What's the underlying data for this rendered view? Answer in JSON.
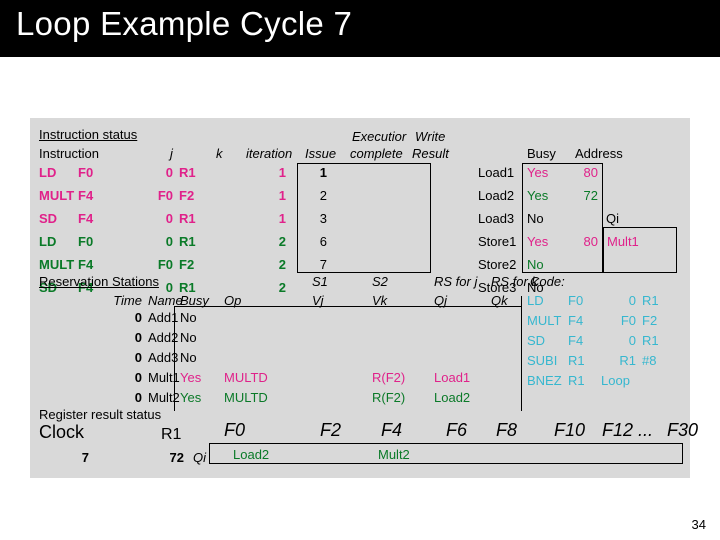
{
  "slide": {
    "title": "Loop Example Cycle 7",
    "page_number": "34"
  },
  "instruction_status": {
    "section_label": "Instruction status",
    "headers": {
      "instruction": "Instruction",
      "j": "j",
      "k": "k",
      "iteration": "iteration",
      "issue": "Issue",
      "execution_line1": "Executior",
      "execution_line2": "complete",
      "write_line1": "Write",
      "write_line2": "Result"
    },
    "rows": [
      {
        "op": "LD",
        "dest": "F0",
        "j": "0",
        "k": "R1",
        "iteration": "1",
        "issue": "1",
        "exec_complete": "",
        "write_result": "",
        "color": "pink"
      },
      {
        "op": "MULT",
        "dest": "F4",
        "j": "F0",
        "k": "F2",
        "iteration": "1",
        "issue": "2",
        "exec_complete": "",
        "write_result": "",
        "color": "pink"
      },
      {
        "op": "SD",
        "dest": "F4",
        "j": "0",
        "k": "R1",
        "iteration": "1",
        "issue": "3",
        "exec_complete": "",
        "write_result": "",
        "color": "pink"
      },
      {
        "op": "LD",
        "dest": "F0",
        "j": "0",
        "k": "R1",
        "iteration": "2",
        "issue": "6",
        "exec_complete": "",
        "write_result": "",
        "color": "green"
      },
      {
        "op": "MULT",
        "dest": "F4",
        "j": "F0",
        "k": "F2",
        "iteration": "2",
        "issue": "7",
        "exec_complete": "",
        "write_result": "",
        "color": "green"
      },
      {
        "op": "SD",
        "dest": "F4",
        "j": "0",
        "k": "R1",
        "iteration": "2",
        "issue": "",
        "exec_complete": "",
        "write_result": "",
        "color": "green"
      }
    ]
  },
  "load_store_units": {
    "headers": {
      "busy": "Busy",
      "address": "Address",
      "qi": "Qi"
    },
    "rows": [
      {
        "name": "Load1",
        "busy": "Yes",
        "address": "80",
        "qi": "",
        "color": "pink"
      },
      {
        "name": "Load2",
        "busy": "Yes",
        "address": "72",
        "qi": "",
        "color": "green"
      },
      {
        "name": "Load3",
        "busy": "No",
        "address": "",
        "qi": "",
        "color": "black"
      },
      {
        "name": "Store1",
        "busy": "Yes",
        "address": "80",
        "qi": "Mult1",
        "color": "pink"
      },
      {
        "name": "Store2",
        "busy": "No",
        "address": "",
        "qi": "",
        "color": "green"
      },
      {
        "name": "Store3",
        "busy": "No",
        "address": "",
        "qi": "",
        "color": "black"
      }
    ]
  },
  "reservation_stations": {
    "section_label": "Reservation Stations",
    "headers": {
      "time": "Time",
      "name": "Name",
      "busy": "Busy",
      "op": "Op",
      "s1": "S1",
      "vj": "Vj",
      "s2": "S2",
      "vk": "Vk",
      "rs_for_j": "RS for j",
      "qj": "Qj",
      "rs_for_k": "RS for k",
      "qk": "Qk"
    },
    "rows": [
      {
        "time": "0",
        "name": "Add1",
        "busy": "No",
        "op": "",
        "vj": "",
        "vk": "",
        "qj": "",
        "qk": "",
        "color": "black"
      },
      {
        "time": "0",
        "name": "Add2",
        "busy": "No",
        "op": "",
        "vj": "",
        "vk": "",
        "qj": "",
        "qk": "",
        "color": "black"
      },
      {
        "time": "0",
        "name": "Add3",
        "busy": "No",
        "op": "",
        "vj": "",
        "vk": "",
        "qj": "",
        "qk": "",
        "color": "black"
      },
      {
        "time": "0",
        "name": "Mult1",
        "busy": "Yes",
        "op": "MULTD",
        "vj": "",
        "vk": "R(F2)",
        "qj": "Load1",
        "qk": "",
        "color": "pink"
      },
      {
        "time": "0",
        "name": "Mult2",
        "busy": "Yes",
        "op": "MULTD",
        "vj": "",
        "vk": "R(F2)",
        "qj": "Load2",
        "qk": "",
        "color": "green"
      }
    ]
  },
  "code": {
    "label": "Code:",
    "lines": [
      {
        "op": "LD",
        "a": "F0",
        "b": "0",
        "c": "R1"
      },
      {
        "op": "MULT",
        "a": "F4",
        "b": "F0",
        "c": "F2"
      },
      {
        "op": "SD",
        "a": "F4",
        "b": "0",
        "c": "R1"
      },
      {
        "op": "SUBI",
        "a": "R1",
        "b": "R1",
        "c": "#8"
      },
      {
        "op": "BNEZ",
        "a": "R1",
        "b": "Loop",
        "c": ""
      }
    ]
  },
  "register_result_status": {
    "section_label": "Register result status",
    "clock_label": "Clock",
    "clock_value": "7",
    "r1_label": "R1",
    "r1_value": "72",
    "qi_label": "Qi",
    "register_headers": [
      "F0",
      "F2",
      "F4",
      "F6",
      "F8",
      "F10",
      "F12 ...",
      "F30"
    ],
    "register_values": [
      {
        "reg": "F0",
        "value": "Load2",
        "color": "green"
      },
      {
        "reg": "F2",
        "value": "",
        "color": "black"
      },
      {
        "reg": "F4",
        "value": "Mult2",
        "color": "green"
      },
      {
        "reg": "F6",
        "value": "",
        "color": "black"
      },
      {
        "reg": "F8",
        "value": "",
        "color": "black"
      },
      {
        "reg": "F10",
        "value": "",
        "color": "black"
      },
      {
        "reg": "F12 ...",
        "value": "",
        "color": "black"
      },
      {
        "reg": "F30",
        "value": "",
        "color": "black"
      }
    ]
  },
  "colors": {
    "pink": "#e0218a",
    "green": "#0a7a28",
    "cyan": "#36b7cf",
    "panel_background": "#d9d9d9",
    "title_background": "#000000",
    "title_text": "#ffffff"
  }
}
